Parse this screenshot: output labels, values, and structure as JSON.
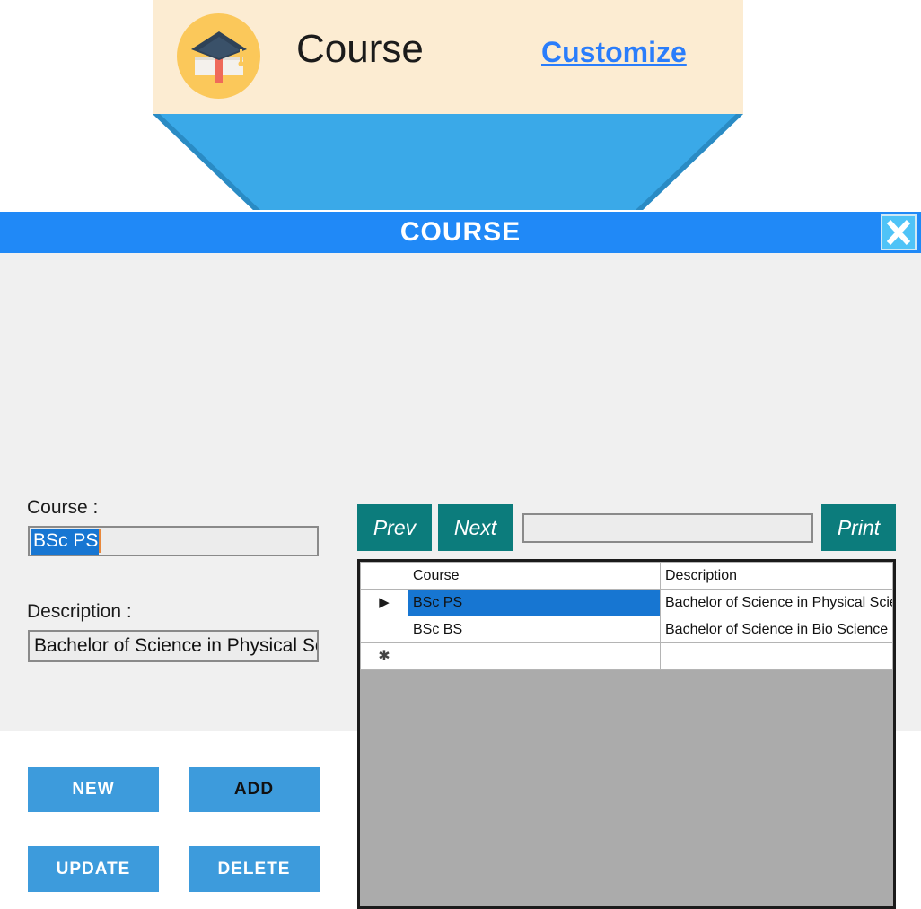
{
  "header": {
    "icon": "graduation-cap-icon",
    "title": "Course",
    "customize_link": "Customize",
    "background_color": "#fcecd2",
    "icon_circle_color": "#fbc85a",
    "link_color": "#2a7dfb",
    "funnel_color": "#3aa9e8"
  },
  "dialog": {
    "title": "COURSE",
    "titlebar_color": "#2089f7",
    "close_icon": "close-x-icon",
    "background_color": "#f0f0f0"
  },
  "form": {
    "course_label": "Course :",
    "course_value": "BSc PS",
    "course_value_selected": true,
    "description_label": "Description :",
    "description_value": "Bachelor of Science in Physical Sc",
    "selection_color": "#1776d2",
    "caret_color": "#e8873a"
  },
  "buttons": {
    "new": "NEW",
    "add": "ADD",
    "update": "UPDATE",
    "delete": "DELETE",
    "color": "#3d9bdc"
  },
  "toolbar": {
    "prev": "Prev",
    "next": "Next",
    "print": "Print",
    "search_value": "",
    "search_placeholder": "",
    "button_color": "#0c7c7c"
  },
  "grid": {
    "row_selector_header": "",
    "columns": [
      "Course",
      "Description"
    ],
    "rows": [
      {
        "marker": "▶",
        "course": "BSc PS",
        "description": "Bachelor of Science in Physical Science",
        "selected": true
      },
      {
        "marker": "",
        "course": "BSc BS",
        "description": "Bachelor of Science in Bio Science",
        "selected": false
      },
      {
        "marker": "✱",
        "course": "",
        "description": "",
        "selected": false
      }
    ],
    "empty_area_color": "#ababab",
    "selection_color": "#1776d2"
  }
}
